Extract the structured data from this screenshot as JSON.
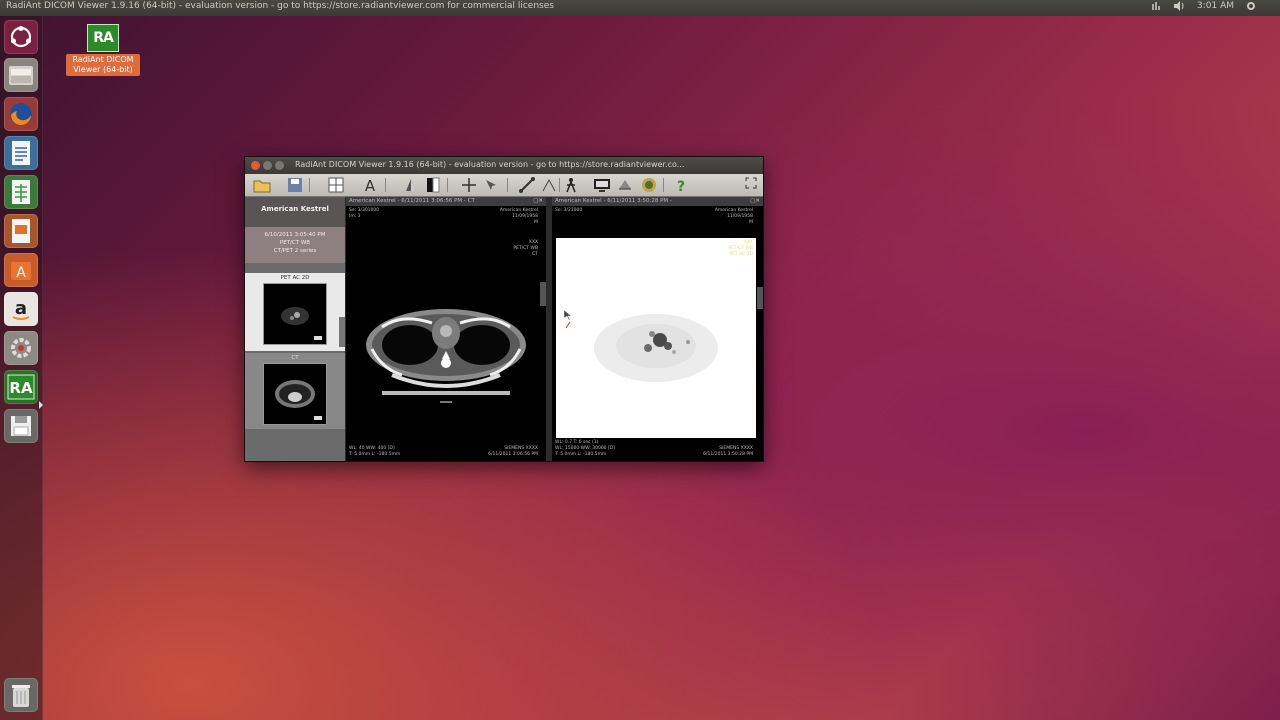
{
  "top_panel": {
    "title": "RadiAnt DICOM Viewer 1.9.16 (64-bit) - evaluation version - go to https://store.radiantviewer.com for commercial licenses",
    "clock": "3:01 AM"
  },
  "launcher": {
    "items": [
      "ubuntu-dash",
      "files",
      "firefox",
      "libreoffice-writer",
      "libreoffice-calc",
      "libreoffice-impress",
      "ubuntu-software-center",
      "amazon",
      "system-settings",
      "radiant-dicom-viewer",
      "save-floppy"
    ],
    "trash": "trash"
  },
  "desktop": {
    "icon_label": "RadiAnt DICOM Viewer (64-bit)",
    "icon_text": "RA"
  },
  "window": {
    "title": "RadiAnt DICOM Viewer 1.9.16 (64-bit) - evaluation version - go to https://store.radiantviewer.co..."
  },
  "browser": {
    "patient_name": "American Kestrel",
    "study_line1": "6/10/2011 3:05:40 PM",
    "study_line2": "PET/CT WB",
    "study_line3": "CT/PET 2 series",
    "series1_label": "PET AC 2D",
    "series2_label": "CT"
  },
  "viewport_ct": {
    "header": "American Kestrel - 6/11/2011 3:06:56 PM - CT",
    "top_left": "Se: 3/301000\nIm: 3",
    "top_right": "American Kestrel\n11/09/1958\nM",
    "mid_right": "XXX\nPET/CT WB\nCT",
    "bottom_left": "WL: 40 WW: 400 [D]\nT: 5.0mm L: -180.5mm",
    "bottom_right": "SIEMENS XXXX\n6/11/2011 3:06:56 PM"
  },
  "viewport_pet": {
    "header": "American Kestrel - 6/11/2011 3:50:28 PM -",
    "top_left": "Se: 3/21000",
    "top_right": "American Kestrel\n11/09/1958\nM",
    "mid_right": "XXX\nPET/CT WB\nPET AC 2D",
    "bottom_left": "WL: 0.7 T: 6 sec (1)\nWL: 15000 WW: 30000 [D]\nT: 5.0mm L: -180.5mm",
    "bottom_right": "SIEMENS XXXX\n6/11/2011 3:50:28 PM"
  }
}
